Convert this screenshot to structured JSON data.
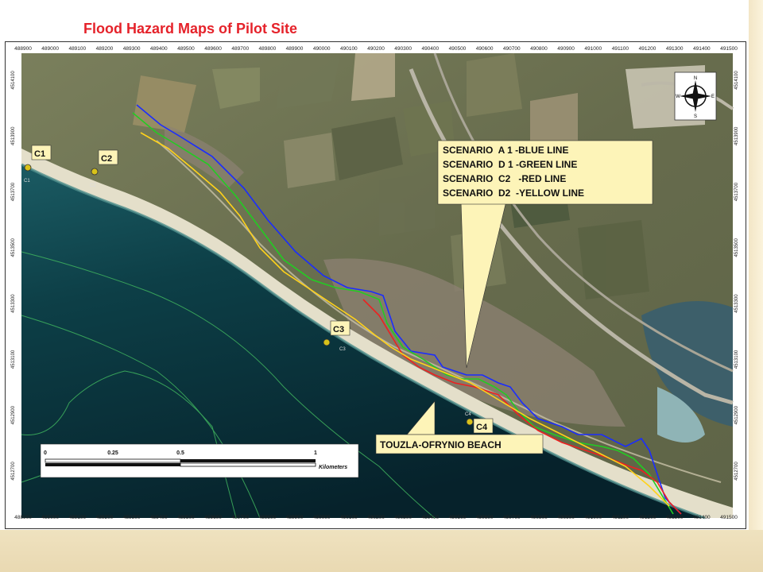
{
  "title": "Flood Hazard Maps of Pilot Site",
  "coords": {
    "x_ticks": [
      "488900",
      "489000",
      "489100",
      "489200",
      "489300",
      "489400",
      "489500",
      "489600",
      "489700",
      "489800",
      "489900",
      "490000",
      "490100",
      "490200",
      "490300",
      "490400",
      "490500",
      "490600",
      "490700",
      "490800",
      "490900",
      "491000",
      "491100",
      "491200",
      "491300",
      "491400",
      "491500"
    ],
    "y_ticks": [
      "4514100",
      "4513900",
      "4513700",
      "4513500",
      "4513300",
      "4513100",
      "4512900",
      "4512700"
    ]
  },
  "compass": {
    "n": "N",
    "s": "S",
    "e": "E",
    "w": "W"
  },
  "points": [
    {
      "id": "C1",
      "label": "C1",
      "sub": "C1"
    },
    {
      "id": "C2",
      "label": "C2",
      "sub": "C2"
    },
    {
      "id": "C3",
      "label": "C3",
      "sub": "C3"
    },
    {
      "id": "C4",
      "label": "C4",
      "sub": "C4"
    }
  ],
  "legend": [
    "SCENARIO  A 1 -BLUE LINE",
    "SCENARIO  D 1 -GREEN LINE",
    "SCENARIO  C2   -RED LINE",
    "SCENARIO  D2  -YELLOW LINE"
  ],
  "beach_label": "TOUZLA-OFRYNIO BEACH",
  "scale": {
    "ticks": [
      "0",
      "0.25",
      "0.5",
      "1"
    ],
    "unit": "Kilometers"
  },
  "colors": {
    "blue": "#1a2cff",
    "green": "#22cc22",
    "red": "#ee2020",
    "yellow": "#ffd21a",
    "callout": "#fdf4b8",
    "title": "#e5222a",
    "sea": "#0c3b44",
    "land": "#6d7252"
  }
}
